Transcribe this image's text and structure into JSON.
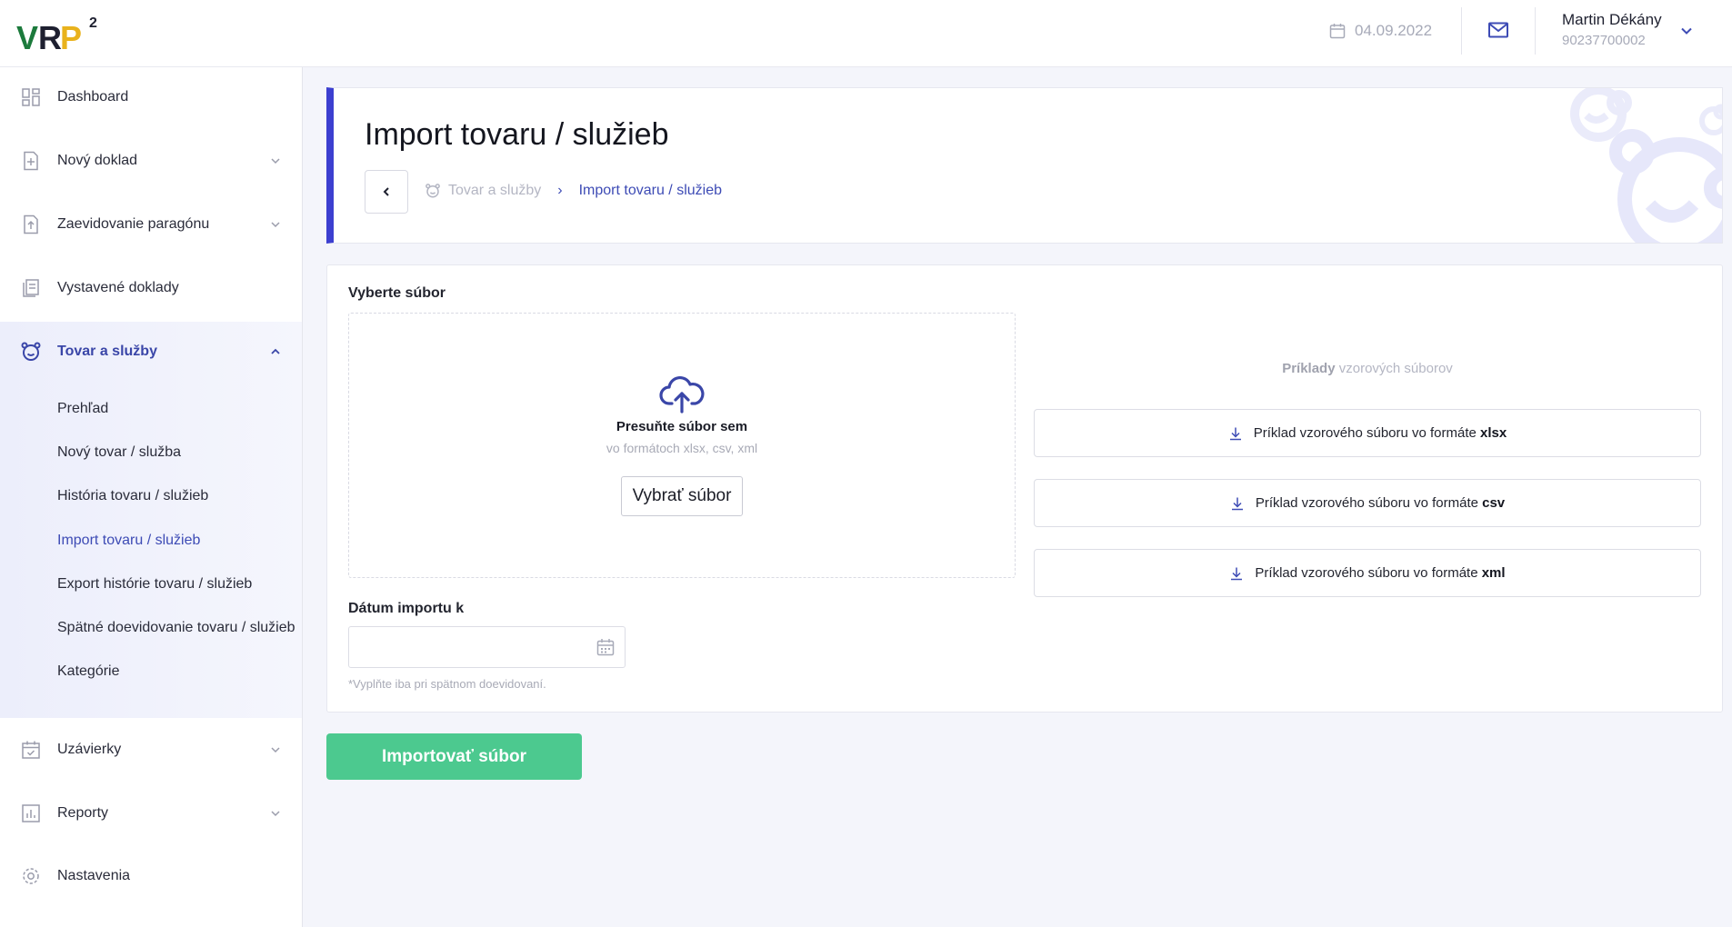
{
  "brand": {
    "logo_text": "VRP",
    "logo_sup": "2"
  },
  "topbar": {
    "date": "04.09.2022",
    "user_name": "Martin Dékány",
    "user_id": "90237700002"
  },
  "sidebar": {
    "items": [
      {
        "label": "Dashboard",
        "icon": "dashboard-icon"
      },
      {
        "label": "Nový doklad",
        "icon": "new-document-icon"
      },
      {
        "label": "Zaevidovanie paragónu",
        "icon": "receipt-upload-icon"
      },
      {
        "label": "Vystavené doklady",
        "icon": "issued-documents-icon"
      },
      {
        "label": "Tovar a služby",
        "icon": "bear-icon"
      },
      {
        "label": "Uzávierky",
        "icon": "calendar-check-icon"
      },
      {
        "label": "Reporty",
        "icon": "chart-icon"
      },
      {
        "label": "Nastavenia",
        "icon": "gear-icon"
      }
    ],
    "sub_items": [
      "Prehľad",
      "Nový tovar / služba",
      "História tovaru / služieb",
      "Import tovaru / služieb",
      "Export histórie tovaru / služieb",
      "Spätné doevidovanie tovaru / služieb",
      "Kategórie"
    ]
  },
  "header": {
    "title": "Import tovaru / služieb",
    "breadcrumb_parent": "Tovar a služby",
    "breadcrumb_sep": "›",
    "breadcrumb_current": "Import tovaru / služieb"
  },
  "upload": {
    "section_label": "Vyberte súbor",
    "drop_title": "Presuňte súbor sem",
    "drop_hint": "vo formátoch xlsx, csv, xml",
    "choose_button": "Vybrať súbor"
  },
  "examples": {
    "title_bold": "Príklady",
    "title_rest": " vzorových súborov",
    "prefix": "Príklad vzorového súboru vo formáte ",
    "formats": [
      "xlsx",
      "csv",
      "xml"
    ]
  },
  "date_field": {
    "label": "Dátum importu k",
    "value": "",
    "note": "*Vyplňte iba pri spätnom doevidovaní."
  },
  "actions": {
    "import_button": "Importovať súbor"
  },
  "colors": {
    "accent": "#3c3fd0",
    "nav_active": "#3a46a8",
    "success": "#4cc98f"
  }
}
